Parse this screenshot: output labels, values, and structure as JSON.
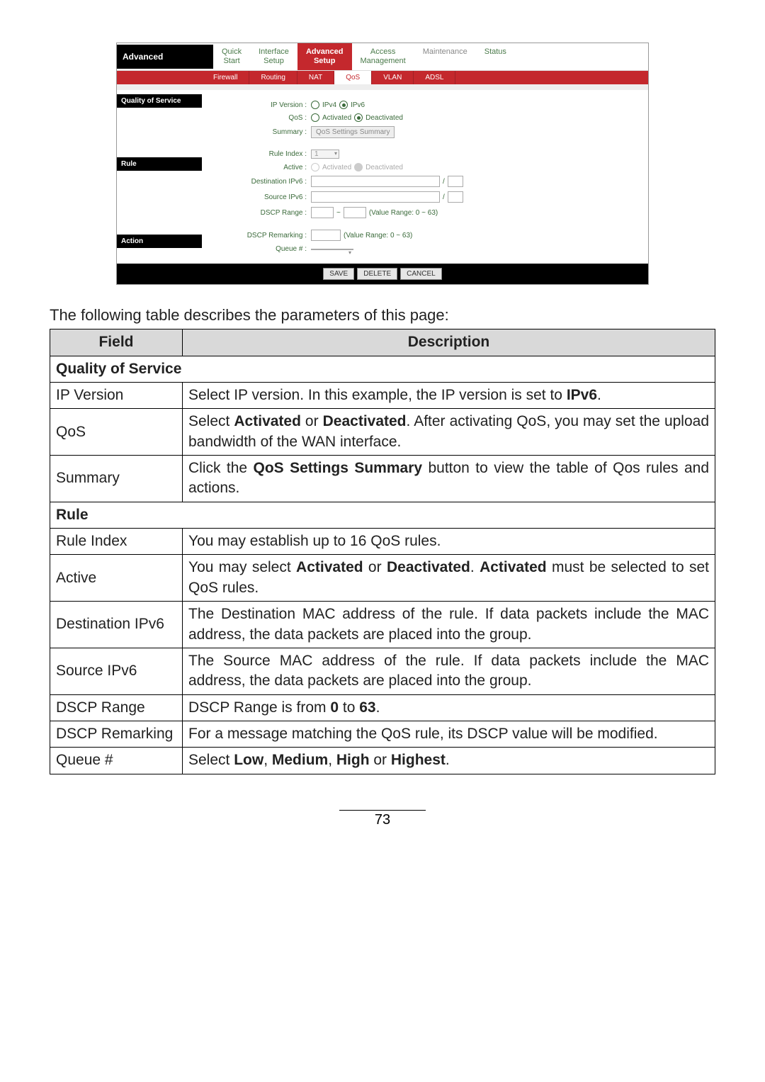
{
  "nav": {
    "brand": "Advanced",
    "tabs": [
      "Quick\nStart",
      "Interface\nSetup",
      "Advanced\nSetup",
      "Access\nManagement",
      "Maintenance",
      "Status"
    ],
    "active_index": 2,
    "subtabs": [
      "Firewall",
      "Routing",
      "NAT",
      "QoS",
      "VLAN",
      "ADSL"
    ],
    "sub_active_index": 3
  },
  "sections": {
    "qos": {
      "title": "Quality of Service"
    },
    "rule": {
      "title": "Rule"
    },
    "action": {
      "title": "Action"
    }
  },
  "form": {
    "ip_version": {
      "label": "IP Version :",
      "opts": [
        "IPv4",
        "IPv6"
      ],
      "selected": "IPv6"
    },
    "qos": {
      "label": "QoS :",
      "opts": [
        "Activated",
        "Deactivated"
      ],
      "selected": "Deactivated"
    },
    "summary": {
      "label": "Summary :",
      "btn": "QoS Settings Summary"
    },
    "rule_index": {
      "label": "Rule Index :",
      "value": "1"
    },
    "active": {
      "label": "Active :",
      "opts": [
        "Activated",
        "Deactivated"
      ],
      "selected": "Deactivated"
    },
    "dest_ipv6": {
      "label": "Destination IPv6 :"
    },
    "source_ipv6": {
      "label": "Source IPv6 :"
    },
    "dscp_range": {
      "label": "DSCP Range :",
      "sep": "~",
      "note": "(Value Range: 0 ~ 63)"
    },
    "dscp_remarking": {
      "label": "DSCP Remarking :",
      "note": "(Value Range: 0 ~ 63)"
    },
    "queue": {
      "label": "Queue # :"
    }
  },
  "buttons": {
    "save": "SAVE",
    "delete": "DELETE",
    "cancel": "CANCEL"
  },
  "intro": "The following table describes the parameters of this page:",
  "table": {
    "headers": [
      "Field",
      "Description"
    ],
    "rows": [
      {
        "type": "section",
        "text": "Quality of Service"
      },
      {
        "field": "IP Version",
        "desc": "Select IP version. In this example, the IP version is set to <b>IPv6</b>."
      },
      {
        "field": "QoS",
        "desc": "Select <b>Activated</b> or <b>Deactivated</b>. After activating QoS, you may set the upload bandwidth of the WAN interface."
      },
      {
        "field": "Summary",
        "desc": "Click the <b>QoS Settings Summary</b> button to view the table of Qos rules and actions."
      },
      {
        "type": "section",
        "text": "Rule"
      },
      {
        "field": "Rule Index",
        "desc": "You may establish up to 16 QoS rules."
      },
      {
        "field": "Active",
        "desc": "You may select <b>Activated</b> or <b>Deactivated</b>. <b>Activated</b> must be selected to set QoS rules."
      },
      {
        "field": "Destination IPv6",
        "desc": "The Destination MAC address of the rule. If data packets include the MAC address, the data packets are placed into the group."
      },
      {
        "field": "Source IPv6",
        "desc": "The Source MAC address of the rule. If data packets include the MAC address, the data packets are placed into the group."
      },
      {
        "field": "DSCP Range",
        "desc": "DSCP Range is from <b>0</b> to <b>63</b>."
      },
      {
        "field": "DSCP Remarking",
        "desc": "For a message matching the QoS rule, its DSCP value will be modified."
      },
      {
        "field": "Queue #",
        "desc": "Select <b>Low</b>, <b>Medium</b>, <b>High</b> or <b>Highest</b>."
      }
    ]
  },
  "page_number": "73"
}
